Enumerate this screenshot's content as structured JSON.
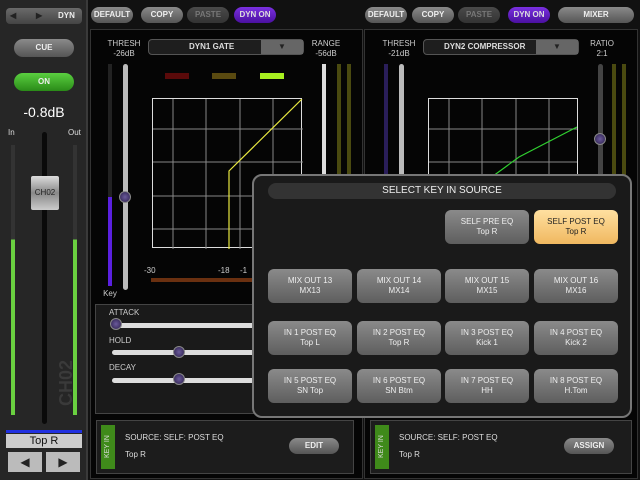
{
  "strip": {
    "prev": "◀",
    "next": "▶",
    "dyn": "DYN",
    "cue": "CUE",
    "on": "ON",
    "level": "-0.8dB",
    "in": "In",
    "out": "Out",
    "fader_label": "CH02",
    "watermark": "CH02",
    "name": "Top R",
    "left_arrow": "◀",
    "right_arrow": "▶"
  },
  "toolbar1": {
    "default": "DEFAULT",
    "copy": "COPY",
    "paste": "PASTE",
    "dyn_on": "DYN ON"
  },
  "toolbar2": {
    "default": "DEFAULT",
    "copy": "COPY",
    "paste": "PASTE",
    "dyn_on": "DYN ON",
    "mixer": "MIXER"
  },
  "dyn1": {
    "type": "DYN1 GATE",
    "thresh_label": "THRESH",
    "thresh": "-26dB",
    "range_label": "RANGE",
    "range": "-56dB",
    "key": "Key",
    "scale": [
      "-30",
      "-18",
      "-1"
    ],
    "attack": "ATTACK",
    "hold": "HOLD",
    "decay": "DECAY",
    "attack_pos": 0,
    "hold_pos": 0.45,
    "decay_pos": 0.45,
    "source": "SOURCE:  SELF: POST EQ",
    "source_name": "Top R",
    "key_in": "KEY IN",
    "edit": "EDIT",
    "curve_color": "#e8e840",
    "indicator_colors": [
      "#5a0a0a",
      "#5a4a10",
      "#a8f020"
    ]
  },
  "dyn2": {
    "type": "DYN2 COMPRESSOR",
    "thresh_label": "THRESH",
    "thresh": "-21dB",
    "ratio_label": "RATIO",
    "ratio": "2:1",
    "source": "SOURCE:  SELF: POST EQ",
    "source_name": "Top R",
    "key_in": "KEY IN",
    "assign": "ASSIGN",
    "curve_color": "#30d030"
  },
  "popup": {
    "title": "SELECT KEY IN SOURCE",
    "buttons": [
      {
        "l1": "SELF PRE EQ",
        "l2": "Top R",
        "selected": false
      },
      {
        "l1": "SELF POST EQ",
        "l2": "Top R",
        "selected": true
      },
      {
        "l1": "MIX OUT 13",
        "l2": "MX13"
      },
      {
        "l1": "MIX OUT 14",
        "l2": "MX14"
      },
      {
        "l1": "MIX OUT 15",
        "l2": "MX15"
      },
      {
        "l1": "MIX OUT 16",
        "l2": "MX16"
      },
      {
        "l1": "IN 1 POST EQ",
        "l2": "Top L"
      },
      {
        "l1": "IN 2 POST EQ",
        "l2": "Top R"
      },
      {
        "l1": "IN 3 POST EQ",
        "l2": "Kick 1"
      },
      {
        "l1": "IN 4 POST EQ",
        "l2": "Kick 2"
      },
      {
        "l1": "IN 5 POST EQ",
        "l2": "SN Top"
      },
      {
        "l1": "IN 6 POST EQ",
        "l2": "SN Btm"
      },
      {
        "l1": "IN 7 POST EQ",
        "l2": "HH"
      },
      {
        "l1": "IN 8 POST EQ",
        "l2": "H.Tom"
      }
    ]
  }
}
